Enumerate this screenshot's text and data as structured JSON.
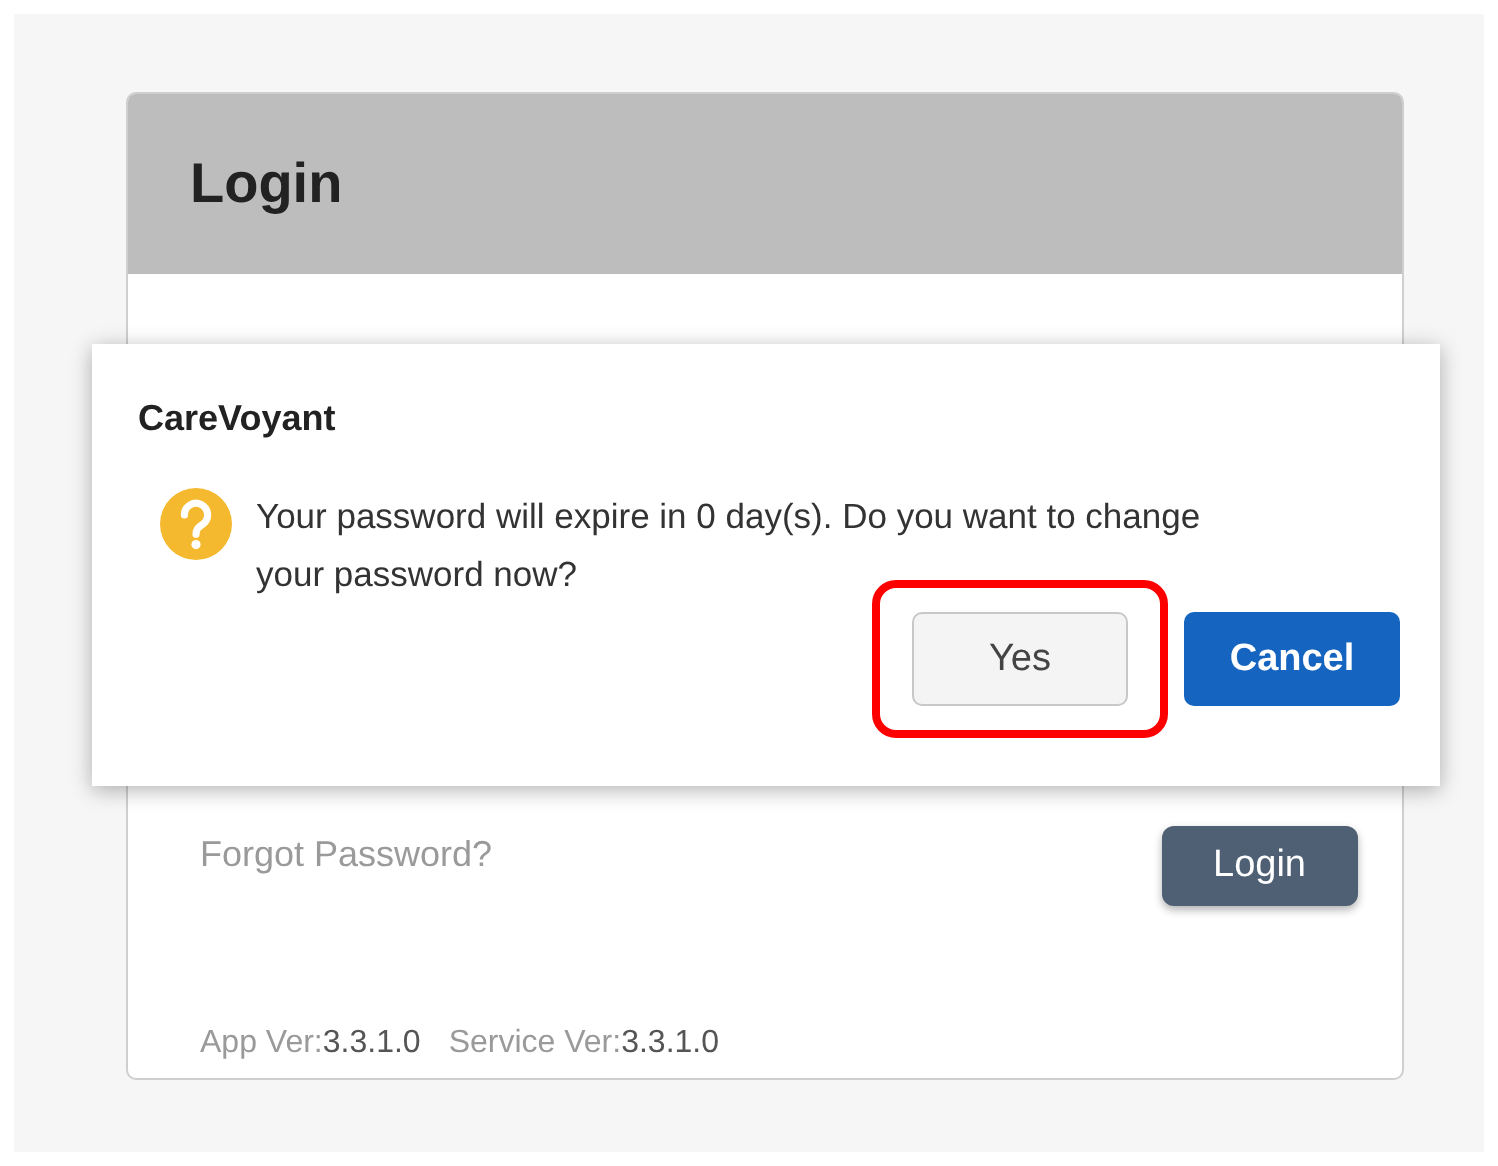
{
  "login_card": {
    "title": "Login",
    "forgot_link": "Forgot Password?",
    "login_button": "Login",
    "versions": [
      {
        "label": "App Ver:",
        "value": "3.3.1.0"
      },
      {
        "label": "Service Ver:",
        "value": "3.3.1.0"
      }
    ]
  },
  "dialog": {
    "title": "CareVoyant",
    "message": "Your password will expire in 0 day(s). Do you want to change your password now?",
    "buttons": [
      {
        "label": "Yes",
        "kind": "secondary",
        "highlighted": true
      },
      {
        "label": "Cancel",
        "kind": "primary",
        "highlighted": false
      }
    ]
  }
}
